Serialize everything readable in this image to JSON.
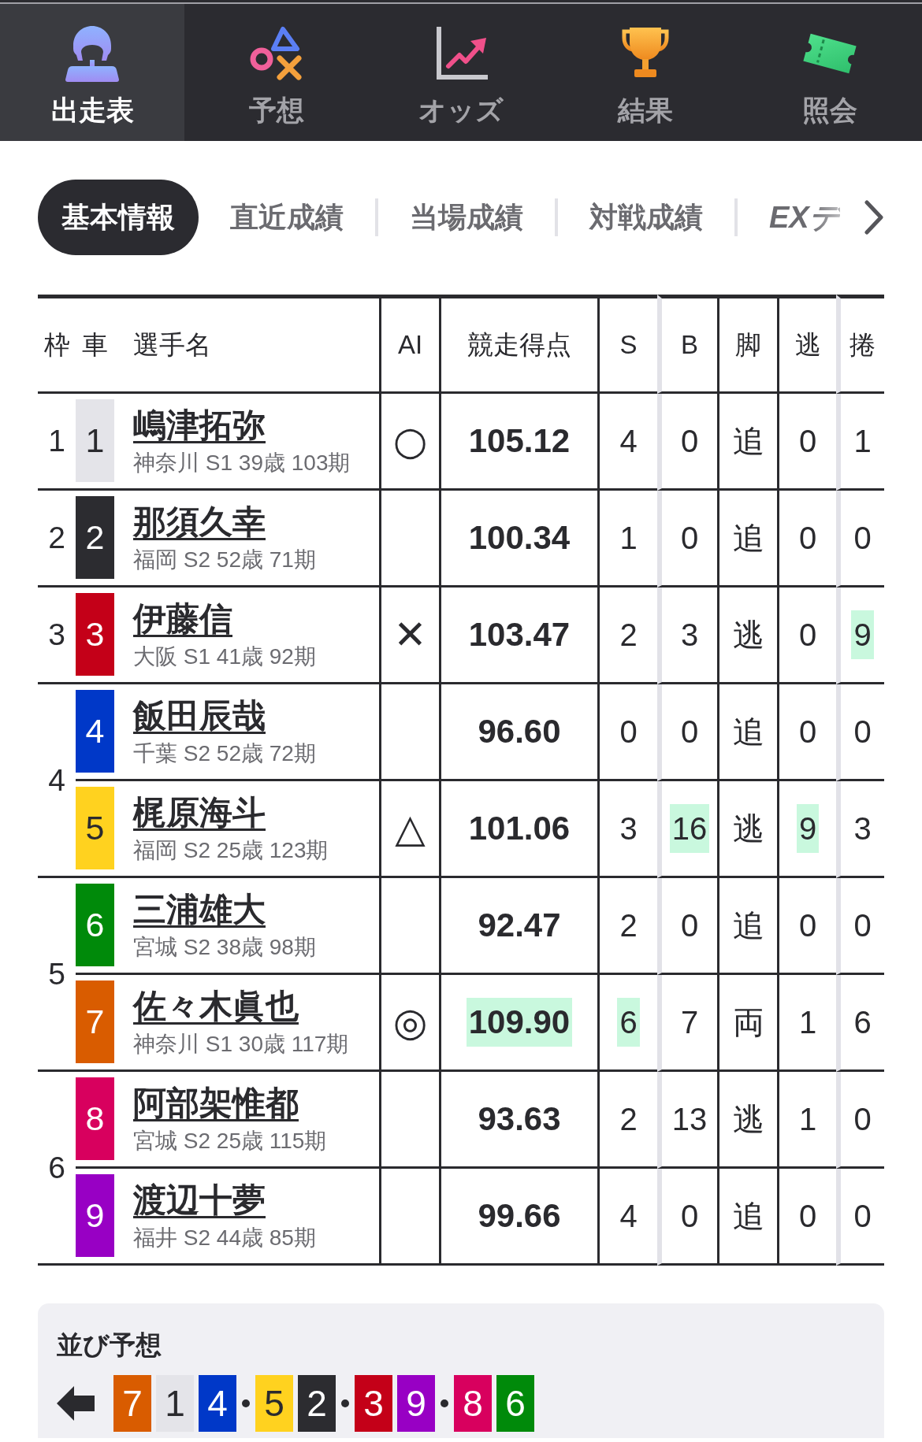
{
  "nav": [
    {
      "label": "出走表",
      "selected": true
    },
    {
      "label": "予想",
      "selected": false
    },
    {
      "label": "オッズ",
      "selected": false
    },
    {
      "label": "結果",
      "selected": false
    },
    {
      "label": "照会",
      "selected": false
    }
  ],
  "info_tabs": [
    {
      "label": "基本情報",
      "kind": "label",
      "selected": true
    },
    {
      "label": "直近成績",
      "kind": "label",
      "selected": false
    },
    {
      "label": "当場成績",
      "kind": "label",
      "selected": false
    },
    {
      "label": "対戦成績",
      "kind": "label",
      "selected": false
    },
    {
      "label": "EXデ",
      "kind": "logo",
      "selected": false
    }
  ],
  "table": {
    "columns": [
      "枠",
      "車",
      "選手名",
      "AI",
      "競走得点",
      "S",
      "B",
      "脚",
      "逃",
      "捲"
    ],
    "frames": [
      {
        "label": "1",
        "riders": [
          {
            "car": "1",
            "color": "#e4e4e9",
            "name": "嶋津拓弥",
            "profile": "神奈川 S1 39歳 103期",
            "ai_mark": "○",
            "score": {
              "text": "105.12",
              "highlighted": false
            },
            "stats": [
              {
                "text": "4",
                "highlighted": false
              },
              {
                "text": "0",
                "highlighted": false
              },
              {
                "text": "追",
                "highlighted": false
              },
              {
                "text": "0",
                "highlighted": false
              },
              {
                "text": "1",
                "highlighted": false
              }
            ]
          }
        ]
      },
      {
        "label": "2",
        "riders": [
          {
            "car": "2",
            "color": "#2c2c30",
            "name": "那須久幸",
            "profile": "福岡 S2 52歳 71期",
            "score": {
              "text": "100.34",
              "highlighted": false
            },
            "stats": [
              {
                "text": "1",
                "highlighted": false
              },
              {
                "text": "0",
                "highlighted": false
              },
              {
                "text": "追",
                "highlighted": false
              },
              {
                "text": "0",
                "highlighted": false
              },
              {
                "text": "0",
                "highlighted": false
              }
            ]
          }
        ]
      },
      {
        "label": "3",
        "riders": [
          {
            "car": "3",
            "color": "#c40018",
            "name": "伊藤信",
            "profile": "大阪 S1 41歳 92期",
            "ai_mark": "✕",
            "score": {
              "text": "103.47",
              "highlighted": false
            },
            "stats": [
              {
                "text": "2",
                "highlighted": false
              },
              {
                "text": "3",
                "highlighted": false
              },
              {
                "text": "逃",
                "highlighted": false
              },
              {
                "text": "0",
                "highlighted": false
              },
              {
                "text": "9",
                "highlighted": true
              }
            ]
          }
        ]
      },
      {
        "label": "4",
        "riders": [
          {
            "car": "4",
            "color": "#0038c8",
            "name": "飯田辰哉",
            "profile": "千葉 S2 52歳 72期",
            "score": {
              "text": "96.60",
              "highlighted": false
            },
            "stats": [
              {
                "text": "0",
                "highlighted": false
              },
              {
                "text": "0",
                "highlighted": false
              },
              {
                "text": "追",
                "highlighted": false
              },
              {
                "text": "0",
                "highlighted": false
              },
              {
                "text": "0",
                "highlighted": false
              }
            ]
          },
          {
            "car": "5",
            "color": "#ffd21f",
            "name": "梶原海斗",
            "profile": "福岡 S2 25歳 123期",
            "ai_mark": "△",
            "score": {
              "text": "101.06",
              "highlighted": false
            },
            "stats": [
              {
                "text": "3",
                "highlighted": false
              },
              {
                "text": "16",
                "highlighted": true
              },
              {
                "text": "逃",
                "highlighted": false
              },
              {
                "text": "9",
                "highlighted": true
              },
              {
                "text": "3",
                "highlighted": false
              }
            ]
          }
        ]
      },
      {
        "label": "5",
        "riders": [
          {
            "car": "6",
            "color": "#008a0a",
            "name": "三浦雄大",
            "profile": "宮城 S2 38歳 98期",
            "score": {
              "text": "92.47",
              "highlighted": false
            },
            "stats": [
              {
                "text": "2",
                "highlighted": false
              },
              {
                "text": "0",
                "highlighted": false
              },
              {
                "text": "追",
                "highlighted": false
              },
              {
                "text": "0",
                "highlighted": false
              },
              {
                "text": "0",
                "highlighted": false
              }
            ]
          },
          {
            "car": "7",
            "color": "#d95c00",
            "name": "佐々木眞也",
            "profile": "神奈川 S1 30歳 117期",
            "ai_mark": "◎",
            "score": {
              "text": "109.90",
              "highlighted": true
            },
            "stats": [
              {
                "text": "6",
                "highlighted": true
              },
              {
                "text": "7",
                "highlighted": false
              },
              {
                "text": "両",
                "highlighted": false
              },
              {
                "text": "1",
                "highlighted": false
              },
              {
                "text": "6",
                "highlighted": false
              }
            ]
          }
        ]
      },
      {
        "label": "6",
        "riders": [
          {
            "car": "8",
            "color": "#d8005e",
            "name": "阿部架惟都",
            "profile": "宮城 S2 25歳 115期",
            "score": {
              "text": "93.63",
              "highlighted": false
            },
            "stats": [
              {
                "text": "2",
                "highlighted": false
              },
              {
                "text": "13",
                "highlighted": false
              },
              {
                "text": "逃",
                "highlighted": false
              },
              {
                "text": "1",
                "highlighted": false
              },
              {
                "text": "0",
                "highlighted": false
              }
            ]
          },
          {
            "car": "9",
            "color": "#9800c4",
            "name": "渡辺十夢",
            "profile": "福井 S2 44歳 85期",
            "score": {
              "text": "99.66",
              "highlighted": false
            },
            "stats": [
              {
                "text": "4",
                "highlighted": false
              },
              {
                "text": "0",
                "highlighted": false
              },
              {
                "text": "追",
                "highlighted": false
              },
              {
                "text": "0",
                "highlighted": false
              },
              {
                "text": "0",
                "highlighted": false
              }
            ]
          }
        ]
      }
    ]
  },
  "lineup": {
    "title": "並び予想",
    "groups": [
      [
        {
          "car": "7",
          "color": "#d95c00"
        },
        {
          "car": "1",
          "color": "#e4e4e9"
        },
        {
          "car": "4",
          "color": "#0038c8"
        }
      ],
      [
        {
          "car": "5",
          "color": "#ffd21f"
        },
        {
          "car": "2",
          "color": "#2c2c30"
        }
      ],
      [
        {
          "car": "3",
          "color": "#c40018"
        },
        {
          "car": "9",
          "color": "#9800c4"
        }
      ],
      [
        {
          "car": "8",
          "color": "#d8005e"
        },
        {
          "car": "6",
          "color": "#008a0a"
        }
      ]
    ]
  }
}
